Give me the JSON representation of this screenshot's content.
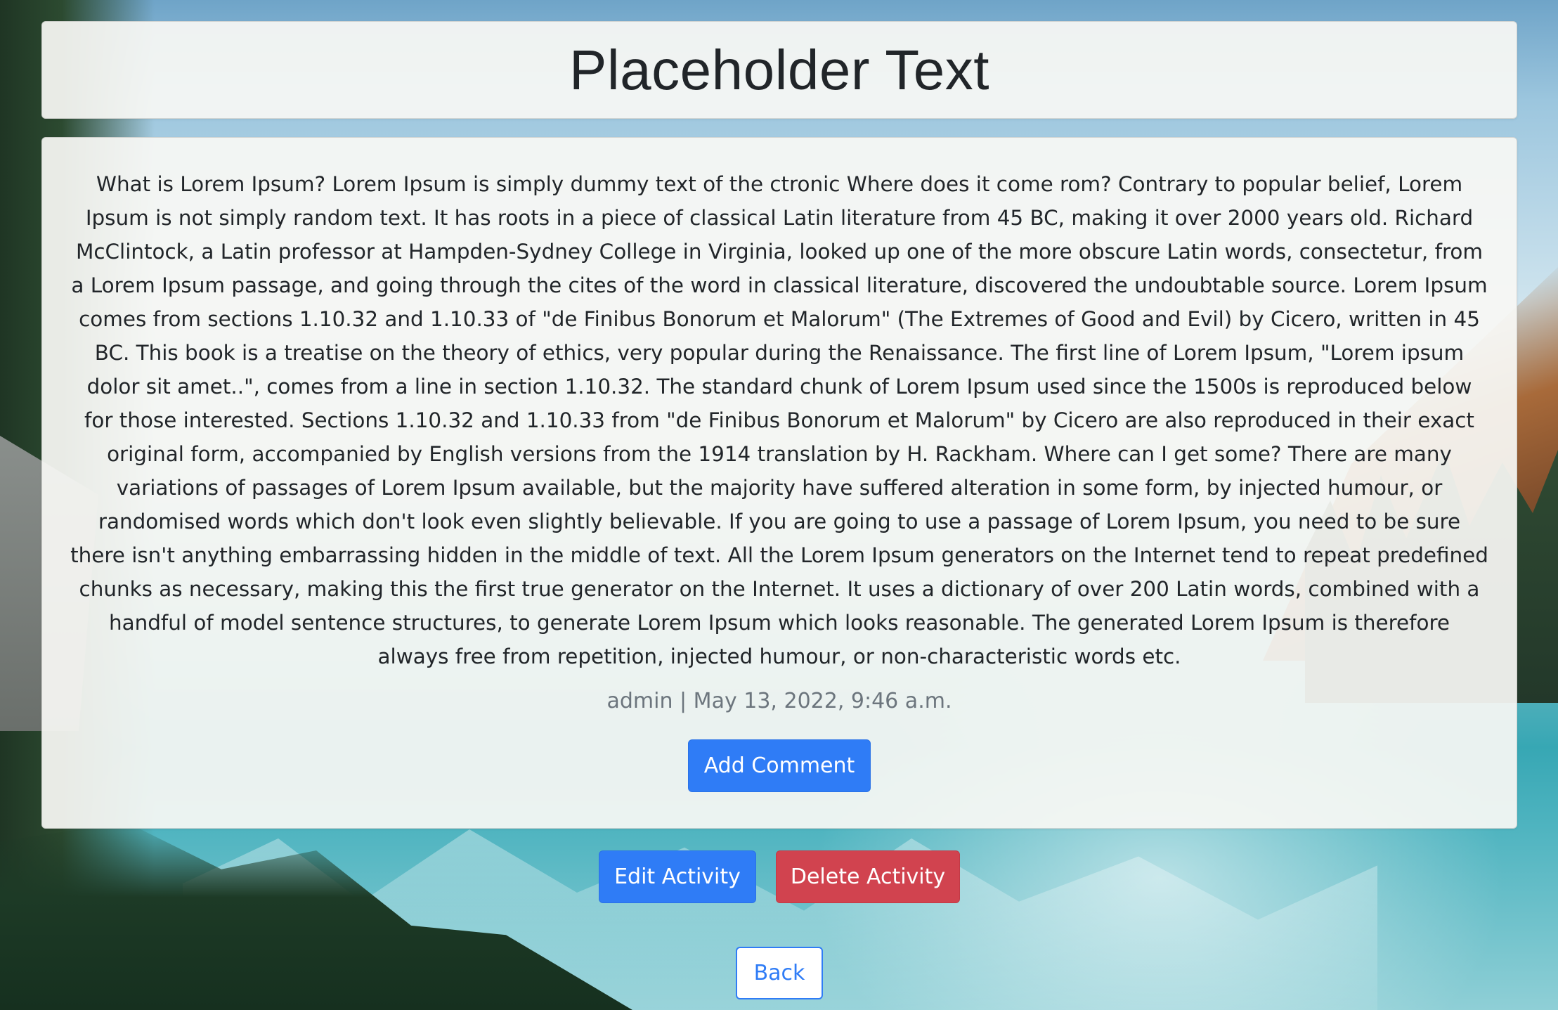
{
  "page": {
    "title": "Placeholder Text",
    "body": "What is Lorem Ipsum? Lorem Ipsum is simply dummy text of the ctronic Where does it come rom? Contrary to popular belief, Lorem Ipsum is not simply random text. It has roots in a piece of classical Latin literature from 45 BC, making it over 2000 years old. Richard McClintock, a Latin professor at Hampden-Sydney College in Virginia, looked up one of the more obscure Latin words, consectetur, from a Lorem Ipsum passage, and going through the cites of the word in classical literature, discovered the undoubtable source. Lorem Ipsum comes from sections 1.10.32 and 1.10.33 of \"de Finibus Bonorum et Malorum\" (The Extremes of Good and Evil) by Cicero, written in 45 BC. This book is a treatise on the theory of ethics, very popular during the Renaissance. The first line of Lorem Ipsum, \"Lorem ipsum dolor sit amet..\", comes from a line in section 1.10.32. The standard chunk of Lorem Ipsum used since the 1500s is reproduced below for those interested. Sections 1.10.32 and 1.10.33 from \"de Finibus Bonorum et Malorum\" by Cicero are also reproduced in their exact original form, accompanied by English versions from the 1914 translation by H. Rackham. Where can I get some? There are many variations of passages of Lorem Ipsum available, but the majority have suffered alteration in some form, by injected humour, or randomised words which don't look even slightly believable. If you are going to use a passage of Lorem Ipsum, you need to be sure there isn't anything embarrassing hidden in the middle of text. All the Lorem Ipsum generators on the Internet tend to repeat predefined chunks as necessary, making this the first true generator on the Internet. It uses a dictionary of over 200 Latin words, combined with a handful of model sentence structures, to generate Lorem Ipsum which looks reasonable. The generated Lorem Ipsum is therefore always free from repetition, injected humour, or non-characteristic words etc.",
    "meta": "admin | May 13, 2022, 9:46 a.m."
  },
  "actions": {
    "add_comment": "Add Comment",
    "edit_activity": "Edit Activity",
    "delete_activity": "Delete Activity",
    "back": "Back"
  },
  "colors": {
    "primary": "#2f7cf6",
    "danger": "#d1434f",
    "muted": "#6c757d",
    "card": "#f8f8f4"
  }
}
